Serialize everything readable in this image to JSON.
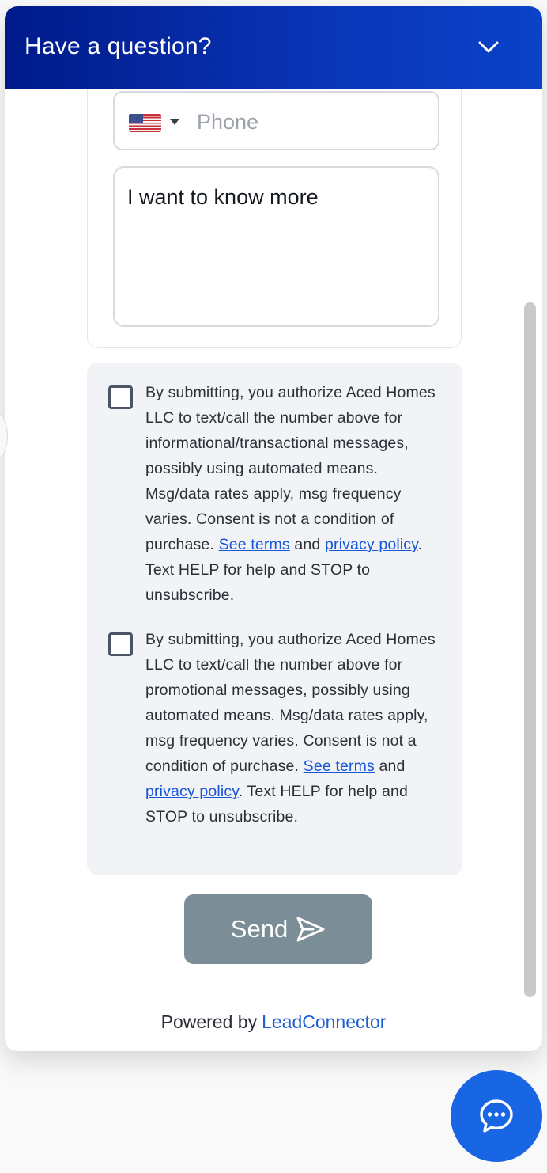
{
  "header": {
    "title": "Have a question?"
  },
  "phone": {
    "placeholder": "Phone",
    "value": ""
  },
  "message": {
    "value": "I want to know more"
  },
  "consents": [
    {
      "before": "By submitting, you authorize Aced Homes LLC to text/call the number above for informational/transactional messages, possibly using automated means. Msg/data rates apply, msg frequency varies. Consent is not a condition of purchase.",
      "link1": "See terms",
      "and": "and",
      "link2": "privacy policy",
      "after": ". Text HELP for help and STOP to unsubscribe."
    },
    {
      "before": "By submitting, you authorize Aced Homes LLC to text/call the number above for promotional messages, possibly using automated means. Msg/data rates apply, msg frequency varies. Consent is not a condition of purchase.",
      "link1": "See terms",
      "and": "and",
      "link2": "privacy policy",
      "after": ". Text HELP for help and STOP to unsubscribe."
    }
  ],
  "send": {
    "label": "Send"
  },
  "footer": {
    "powered_by": "Powered by",
    "brand": "LeadConnector"
  },
  "colors": {
    "header_start": "#001a8a",
    "header_end": "#0a42c8",
    "link": "#1856d8",
    "send_button": "#7b8d96",
    "launcher": "#1966e5"
  },
  "icons": {
    "collapse": "chevron-down-icon",
    "send": "paper-plane-icon",
    "launcher": "chat-bubble-icon",
    "country": "us-flag-icon"
  }
}
